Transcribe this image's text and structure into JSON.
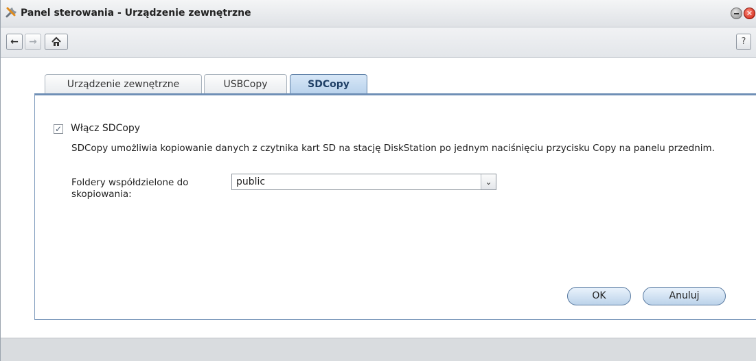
{
  "window": {
    "title": "Panel sterowania - Urządzenie zewnętrzne",
    "app_icon": "tools-icon",
    "minimize_icon": "minimize-icon",
    "close_icon": "close-icon",
    "close_glyph": "✕"
  },
  "toolbar": {
    "back_glyph": "←",
    "forward_glyph": "→",
    "home_glyph": "⌂",
    "help_label": "?"
  },
  "tabs": [
    {
      "label": "Urządzenie zewnętrzne",
      "active": false
    },
    {
      "label": "USBCopy",
      "active": false
    },
    {
      "label": "SDCopy",
      "active": true
    }
  ],
  "form": {
    "enable_checked": true,
    "enable_check_glyph": "✓",
    "enable_label": "Włącz SDCopy",
    "description": "SDCopy umożliwia kopiowanie danych z czytnika kart SD na stację DiskStation po jednym naciśnięciu przycisku Copy na panelu przednim.",
    "shared_folder_label": "Foldery współdzielone do skopiowania:",
    "shared_folder_value": "public",
    "dropdown_glyph": "⌄"
  },
  "buttons": {
    "ok_label": "OK",
    "cancel_label": "Anuluj"
  },
  "colors": {
    "accent": "#5d7fa6",
    "active_tab_bg": "#c9def2",
    "button_bg": "#bcd3ea"
  }
}
